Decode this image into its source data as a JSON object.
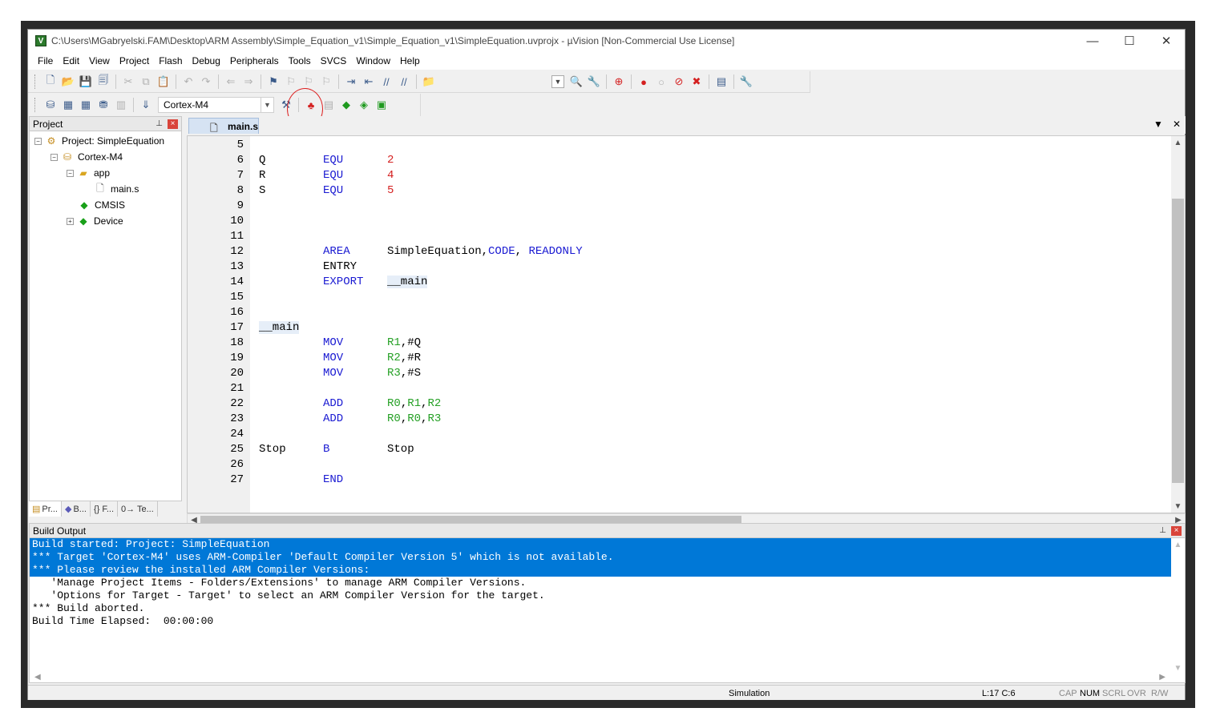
{
  "window": {
    "title": "C:\\Users\\MGabryelski.FAM\\Desktop\\ARM Assembly\\Simple_Equation_v1\\Simple_Equation_v1\\SimpleEquation.uvprojx - µVision  [Non-Commercial Use License]",
    "app_icon_letter": "V",
    "minimize": "—",
    "maximize": "☐",
    "close": "✕"
  },
  "menu": [
    "File",
    "Edit",
    "View",
    "Project",
    "Flash",
    "Debug",
    "Peripherals",
    "Tools",
    "SVCS",
    "Window",
    "Help"
  ],
  "toolbar": {
    "target": "Cortex-M4"
  },
  "project_panel": {
    "title": "Project",
    "pin": "⊥",
    "close": "×",
    "tree": [
      {
        "label": "Project: SimpleEquation",
        "icon": "project-icon",
        "level": 0,
        "expander": "−"
      },
      {
        "label": "Cortex-M4",
        "icon": "target-icon",
        "level": 1,
        "expander": "−"
      },
      {
        "label": "app",
        "icon": "folder-icon",
        "level": 2,
        "expander": "−"
      },
      {
        "label": "main.s",
        "icon": "file-icon",
        "level": 3,
        "expander": ""
      },
      {
        "label": "CMSIS",
        "icon": "diamond-icon",
        "level": 2,
        "expander": ""
      },
      {
        "label": "Device",
        "icon": "diamond-icon",
        "level": 2,
        "expander": "+"
      }
    ],
    "tabs": [
      "Pr...",
      "B...",
      "{} F...",
      "0→ Te..."
    ]
  },
  "editor": {
    "tab": "main.s",
    "lines": [
      {
        "n": "5",
        "label": "",
        "op": "",
        "args": []
      },
      {
        "n": "6",
        "label": "Q",
        "op": "EQU",
        "args": [
          {
            "t": "2",
            "c": "num"
          }
        ]
      },
      {
        "n": "7",
        "label": "R",
        "op": "EQU",
        "args": [
          {
            "t": "4",
            "c": "num"
          }
        ]
      },
      {
        "n": "8",
        "label": "S",
        "op": "EQU",
        "args": [
          {
            "t": "5",
            "c": "num"
          }
        ]
      },
      {
        "n": "9",
        "label": "",
        "op": "",
        "args": []
      },
      {
        "n": "10",
        "label": "",
        "op": "",
        "args": []
      },
      {
        "n": "11",
        "label": "",
        "op": "",
        "args": []
      },
      {
        "n": "12",
        "label": "",
        "op": "AREA",
        "args": [
          {
            "t": "SimpleEquation,",
            "c": "txt"
          },
          {
            "t": "CODE",
            "c": "kw"
          },
          {
            "t": ", ",
            "c": "txt"
          },
          {
            "t": "READONLY",
            "c": "kw"
          }
        ]
      },
      {
        "n": "13",
        "label": "",
        "op": "ENTRY",
        "opc": "txt",
        "args": []
      },
      {
        "n": "14",
        "label": "",
        "op": "EXPORT",
        "args": [
          {
            "t": "__main",
            "c": "hl"
          }
        ]
      },
      {
        "n": "15",
        "label": "",
        "op": "",
        "args": []
      },
      {
        "n": "16",
        "label": "",
        "op": "",
        "args": []
      },
      {
        "n": "17",
        "label": "__main",
        "labelc": "hl",
        "op": "",
        "args": []
      },
      {
        "n": "18",
        "label": "",
        "op": "MOV",
        "args": [
          {
            "t": "R1",
            "c": "reg"
          },
          {
            "t": ",#Q",
            "c": "txt"
          }
        ]
      },
      {
        "n": "19",
        "label": "",
        "op": "MOV",
        "args": [
          {
            "t": "R2",
            "c": "reg"
          },
          {
            "t": ",#R",
            "c": "txt"
          }
        ]
      },
      {
        "n": "20",
        "label": "",
        "op": "MOV",
        "args": [
          {
            "t": "R3",
            "c": "reg"
          },
          {
            "t": ",#S",
            "c": "txt"
          }
        ]
      },
      {
        "n": "21",
        "label": "",
        "op": "",
        "args": []
      },
      {
        "n": "22",
        "label": "",
        "op": "ADD",
        "args": [
          {
            "t": "R0",
            "c": "reg"
          },
          {
            "t": ",",
            "c": "txt"
          },
          {
            "t": "R1",
            "c": "reg"
          },
          {
            "t": ",",
            "c": "txt"
          },
          {
            "t": "R2",
            "c": "reg"
          }
        ]
      },
      {
        "n": "23",
        "label": "",
        "op": "ADD",
        "args": [
          {
            "t": "R0",
            "c": "reg"
          },
          {
            "t": ",",
            "c": "txt"
          },
          {
            "t": "R0",
            "c": "reg"
          },
          {
            "t": ",",
            "c": "txt"
          },
          {
            "t": "R3",
            "c": "reg"
          }
        ]
      },
      {
        "n": "24",
        "label": "",
        "op": "",
        "args": []
      },
      {
        "n": "25",
        "label": "Stop",
        "op": "B",
        "args": [
          {
            "t": "Stop",
            "c": "txt"
          }
        ]
      },
      {
        "n": "26",
        "label": "",
        "op": "",
        "args": []
      },
      {
        "n": "27",
        "label": "",
        "op": "END",
        "args": []
      }
    ]
  },
  "build_output": {
    "title": "Build Output",
    "lines": [
      {
        "text": "Build started: Project: SimpleEquation",
        "selected": true
      },
      {
        "text": "*** Target 'Cortex-M4' uses ARM-Compiler 'Default Compiler Version 5' which is not available.",
        "selected": true
      },
      {
        "text": "*** Please review the installed ARM Compiler Versions:",
        "selected": true
      },
      {
        "text": "   'Manage Project Items - Folders/Extensions' to manage ARM Compiler Versions.",
        "selected": false
      },
      {
        "text": "   'Options for Target - Target' to select an ARM Compiler Version for the target.",
        "selected": false
      },
      {
        "text": "*** Build aborted.",
        "selected": false
      },
      {
        "text": "Build Time Elapsed:  00:00:00",
        "selected": false
      }
    ]
  },
  "status": {
    "mode": "Simulation",
    "position": "L:17 C:6",
    "cap": "CAP",
    "num": "NUM",
    "scrl": "SCRL",
    "ovr": "OVR",
    "rw": "R/W"
  },
  "colors": {
    "keyword": "#1a1ad2",
    "number": "#d42020",
    "register": "#25a025",
    "selection": "#0078d7"
  }
}
